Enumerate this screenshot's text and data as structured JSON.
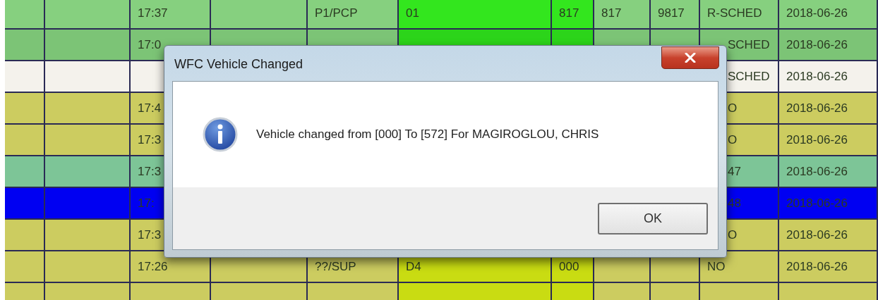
{
  "table": {
    "rows": [
      {
        "color": "#86d07f",
        "cells": [
          null,
          null,
          "17:37",
          null,
          "P1/PCP",
          {
            "text": "01",
            "color": "#33e61e"
          },
          {
            "text": "817",
            "color": "#33e61e"
          },
          "817",
          "9817",
          "R-SCHED",
          "2018-06-26"
        ]
      },
      {
        "color": "#7cc476",
        "cells": [
          null,
          null,
          "17:0",
          null,
          null,
          {
            "color": "#2cd41a"
          },
          {
            "color": "#2cd41a"
          },
          null,
          null,
          "SCHED",
          "2018-06-26"
        ]
      },
      {
        "color": "#f4f2ec",
        "cells": [
          null,
          null,
          null,
          null,
          null,
          null,
          null,
          null,
          null,
          "SCHED",
          "2018-06-26"
        ]
      },
      {
        "color": "#cccc60",
        "cells": [
          null,
          null,
          "17:4",
          null,
          null,
          null,
          null,
          null,
          null,
          "O",
          "2018-06-26"
        ]
      },
      {
        "color": "#cccc60",
        "cells": [
          null,
          null,
          "17:3",
          null,
          null,
          null,
          null,
          null,
          null,
          "O",
          "2018-06-26"
        ]
      },
      {
        "color": "#7dc597",
        "cells": [
          null,
          null,
          "17:3",
          null,
          null,
          null,
          null,
          null,
          null,
          "47",
          "2018-06-26"
        ]
      },
      {
        "color": "#0000f2",
        "cells": [
          null,
          null,
          "17:",
          null,
          null,
          null,
          null,
          null,
          null,
          "48",
          "2018-06-26"
        ]
      },
      {
        "color": "#cccc60",
        "cells": [
          null,
          null,
          "17:3",
          null,
          null,
          null,
          null,
          null,
          null,
          "O",
          "2018-06-26"
        ]
      },
      {
        "color": "#cccc60",
        "cells": [
          null,
          null,
          "17:26",
          null,
          "??/SUP",
          {
            "text": "D4",
            "color": "#c9dc12"
          },
          {
            "text": "000",
            "color": "#c9dc12"
          },
          null,
          null,
          "NO",
          "2018-06-26"
        ]
      },
      {
        "color": "#cccc60",
        "cells": [
          null,
          null,
          null,
          null,
          null,
          {
            "color": "#c9dc12"
          },
          {
            "color": "#c9dc12"
          },
          null,
          null,
          null,
          null
        ]
      }
    ]
  },
  "dialog": {
    "title": "WFC Vehicle Changed",
    "message": "Vehicle changed from [000] To [572] For MAGIROGLOU, CHRIS",
    "buttons": [
      "OK"
    ]
  }
}
